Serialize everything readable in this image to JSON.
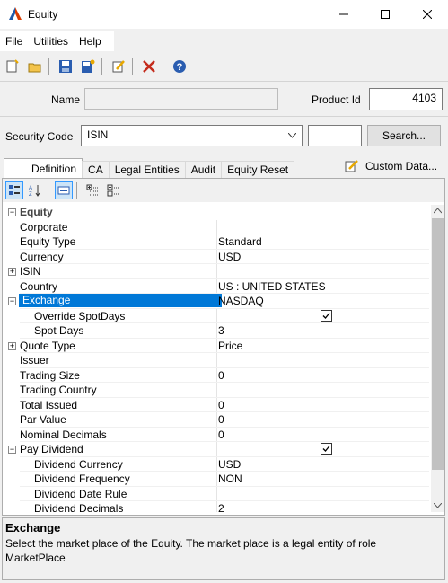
{
  "window": {
    "title": "Equity"
  },
  "menu": [
    "File",
    "Utilities",
    "Help"
  ],
  "toolbar": {
    "icons": [
      "new-icon",
      "open-icon",
      "save-icon",
      "save-as-new-icon",
      "edit-icon",
      "delete-icon",
      "help-icon"
    ]
  },
  "form": {
    "name_label": "Name",
    "name_value": "",
    "product_id_label": "Product Id",
    "product_id_value": "4103",
    "security_code_label": "Security Code",
    "security_code_value": "ISIN",
    "security_code_input": "",
    "search_button": "Search..."
  },
  "tabs": [
    "Definition",
    "CA",
    "Legal Entities",
    "Audit",
    "Equity Reset"
  ],
  "custom_data_label": "Custom Data...",
  "grid": {
    "category": "Equity",
    "rows": [
      {
        "name": "Corporate",
        "value": ""
      },
      {
        "name": "Equity Type",
        "value": "Standard"
      },
      {
        "name": "Currency",
        "value": "USD"
      },
      {
        "name": "ISIN",
        "value": ""
      },
      {
        "name": "Country",
        "value": "US : UNITED STATES"
      },
      {
        "name": "Exchange",
        "value": "NASDAQ"
      },
      {
        "name": "Override SpotDays",
        "value": ""
      },
      {
        "name": "Spot Days",
        "value": "3"
      },
      {
        "name": "Quote Type",
        "value": "Price"
      },
      {
        "name": "Issuer",
        "value": ""
      },
      {
        "name": "Trading Size",
        "value": "0"
      },
      {
        "name": "Trading Country",
        "value": ""
      },
      {
        "name": "Total Issued",
        "value": "0"
      },
      {
        "name": "Par Value",
        "value": "0"
      },
      {
        "name": "Nominal Decimals",
        "value": "0"
      },
      {
        "name": "Pay Dividend",
        "value": ""
      },
      {
        "name": "Dividend Currency",
        "value": "USD"
      },
      {
        "name": "Dividend Frequency",
        "value": "NON"
      },
      {
        "name": "Dividend Date Rule",
        "value": ""
      },
      {
        "name": "Dividend Decimals",
        "value": "2"
      }
    ]
  },
  "help": {
    "title": "Exchange",
    "description": "Select the market place of the Equity. The market place is a legal entity of role MarketPlace"
  },
  "colors": {
    "selection": "#0078d7",
    "accent_red": "#d83b01",
    "accent_blue": "#1e5aa8"
  }
}
